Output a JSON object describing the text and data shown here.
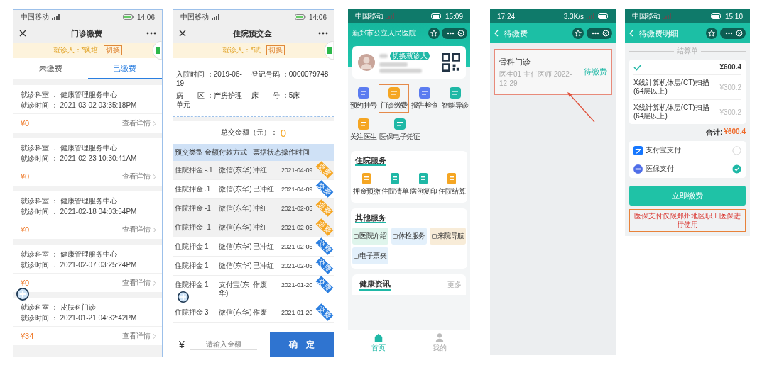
{
  "outpatient_payments": {
    "status_bar": {
      "carrier": "中国移动",
      "time": "14:06"
    },
    "title": "门诊缴费",
    "patient": {
      "name": "就诊人：*飒培",
      "switch": "切换"
    },
    "tabs": [
      {
        "label": "未缴费",
        "selected": false
      },
      {
        "label": "已缴费",
        "selected": true
      }
    ],
    "records": [
      {
        "department": "就诊科室 ： 健康管理服务中心",
        "time": "就诊时间 ： 2021-03-02 03:35:18PM",
        "amount": "¥0",
        "link": "查看详情"
      },
      {
        "department": "就诊科室 ： 健康管理服务中心",
        "time": "就诊时间 ： 2021-02-23 10:30:41AM",
        "amount": "¥0",
        "link": "查看详情"
      },
      {
        "department": "就诊科室 ： 健康管理服务中心",
        "time": "就诊时间 ： 2021-02-18 04:03:54PM",
        "amount": "¥0",
        "link": "查看详情"
      },
      {
        "department": "就诊科室 ： 健康管理服务中心",
        "time": "就诊时间 ： 2021-02-07 03:25:24PM",
        "amount": "¥0",
        "link": "查看详情"
      },
      {
        "department": "就诊科室 ： 皮肤科门诊",
        "time": "就诊时间 ： 2021-01-21 04:32:42PM",
        "amount": "¥34",
        "link": "查看详情"
      }
    ]
  },
  "inpatient_deposit": {
    "status_bar": {
      "carrier": "中国移动",
      "time": "14:06"
    },
    "title": "住院预交金",
    "patient": {
      "name": "就诊人：*试",
      "switch": "切换"
    },
    "info": [
      "入院时间 ：2019-06-19",
      "登记号码 ：0000079748",
      "病　　区 ：产房护理单元",
      "床　　号 ：5床"
    ],
    "total_label": "总交金额（元）：",
    "total": "0",
    "columns": [
      "预交类型",
      "金额",
      "付款方式",
      "票据状态",
      "操作时间"
    ],
    "rows": [
      {
        "kind": "refund",
        "tag": "退费",
        "cells": [
          "住院押金",
          "-.1",
          "微信(东华)",
          "冲红",
          "2021-04-09"
        ]
      },
      {
        "kind": "payment",
        "tag": "交费",
        "cells": [
          "住院押金",
          ".1",
          "微信(东华)",
          "已冲红",
          "2021-04-09"
        ]
      },
      {
        "kind": "refund",
        "tag": "退费",
        "cells": [
          "住院押金",
          "-1",
          "微信(东华)",
          "冲红",
          "2021-02-05"
        ]
      },
      {
        "kind": "refund",
        "tag": "退费",
        "cells": [
          "住院押金",
          "-1",
          "微信(东华)",
          "冲红",
          "2021-02-05"
        ]
      },
      {
        "kind": "payment",
        "tag": "交费",
        "cells": [
          "住院押金",
          "1",
          "微信(东华)",
          "已冲红",
          "2021-02-05"
        ]
      },
      {
        "kind": "payment",
        "tag": "交费",
        "cells": [
          "住院押金",
          "1",
          "微信(东华)",
          "已冲红",
          "2021-02-05"
        ]
      },
      {
        "kind": "payment",
        "tag": "交费",
        "cells": [
          "住院押金",
          "1",
          "支付宝(东华)",
          "作废",
          "2021-01-20"
        ]
      },
      {
        "kind": "payment",
        "tag": "交费",
        "cells": [
          "住院押金",
          "3",
          "微信(东华)",
          "作废",
          "2021-01-20"
        ]
      }
    ],
    "currency": "¥",
    "amount_placeholder": "请输入金额",
    "confirm": "确　定"
  },
  "hospital_home": {
    "status_bar": {
      "carrier": "中国移动",
      "time": "15:09"
    },
    "title": "新郑市公立人民医院",
    "switch_patient": "切换就诊人",
    "shortcuts": [
      {
        "label": "预约挂号",
        "highlighted": false
      },
      {
        "label": "门诊缴费",
        "highlighted": true
      },
      {
        "label": "报告检查",
        "highlighted": false
      },
      {
        "label": "智能导诊",
        "highlighted": false
      },
      {
        "label": "关注医生",
        "highlighted": false
      },
      {
        "label": "医保电子凭证",
        "highlighted": false
      }
    ],
    "inpatient": {
      "title": "住院服务",
      "items": [
        "押金预缴",
        "住院清单",
        "病例复印",
        "住院结算"
      ]
    },
    "other": {
      "title": "其他服务",
      "items": [
        {
          "label": "医院介绍",
          "color": "#dff5ec"
        },
        {
          "label": "体检服务",
          "color": "#e3f0fb"
        },
        {
          "label": "来院导航",
          "color": "#f8ecd8"
        },
        {
          "label": "电子票夹",
          "color": "#e3f0fb"
        }
      ]
    },
    "news": {
      "title": "健康资讯",
      "more": "更多"
    },
    "tabbar": [
      {
        "label": "首页",
        "selected": true
      },
      {
        "label": "我的",
        "selected": false
      }
    ]
  },
  "pending_payments": {
    "status_bar": {
      "time": "17:24",
      "speed": "3.3K/s"
    },
    "title": "待缴费",
    "item": {
      "department": "骨科门诊",
      "meta": "医生01 主任医师 2022-12-29",
      "status": "待缴费",
      "highlighted": true
    }
  },
  "pending_detail": {
    "status_bar": {
      "carrier": "中国移动",
      "time": "15:10"
    },
    "title": "待缴费明细",
    "divider": "结算单",
    "bill": {
      "checked": true,
      "amount": "¥600.4",
      "items": [
        {
          "name": "X线计算机体层(CT)扫描(64层以上)",
          "price": "¥300.2"
        },
        {
          "name": "X线计算机体层(CT)扫描(64层以上)",
          "price": "¥300.2"
        }
      ]
    },
    "total_label": "合计:",
    "total": "¥600.4",
    "methods": [
      {
        "label": "支付宝支付",
        "selected": false
      },
      {
        "label": "医保支付",
        "selected": true
      }
    ],
    "pay": "立即缴费",
    "notice": {
      "text": "医保支付仅限郑州地区职工医保进行使用",
      "highlighted": true
    }
  }
}
